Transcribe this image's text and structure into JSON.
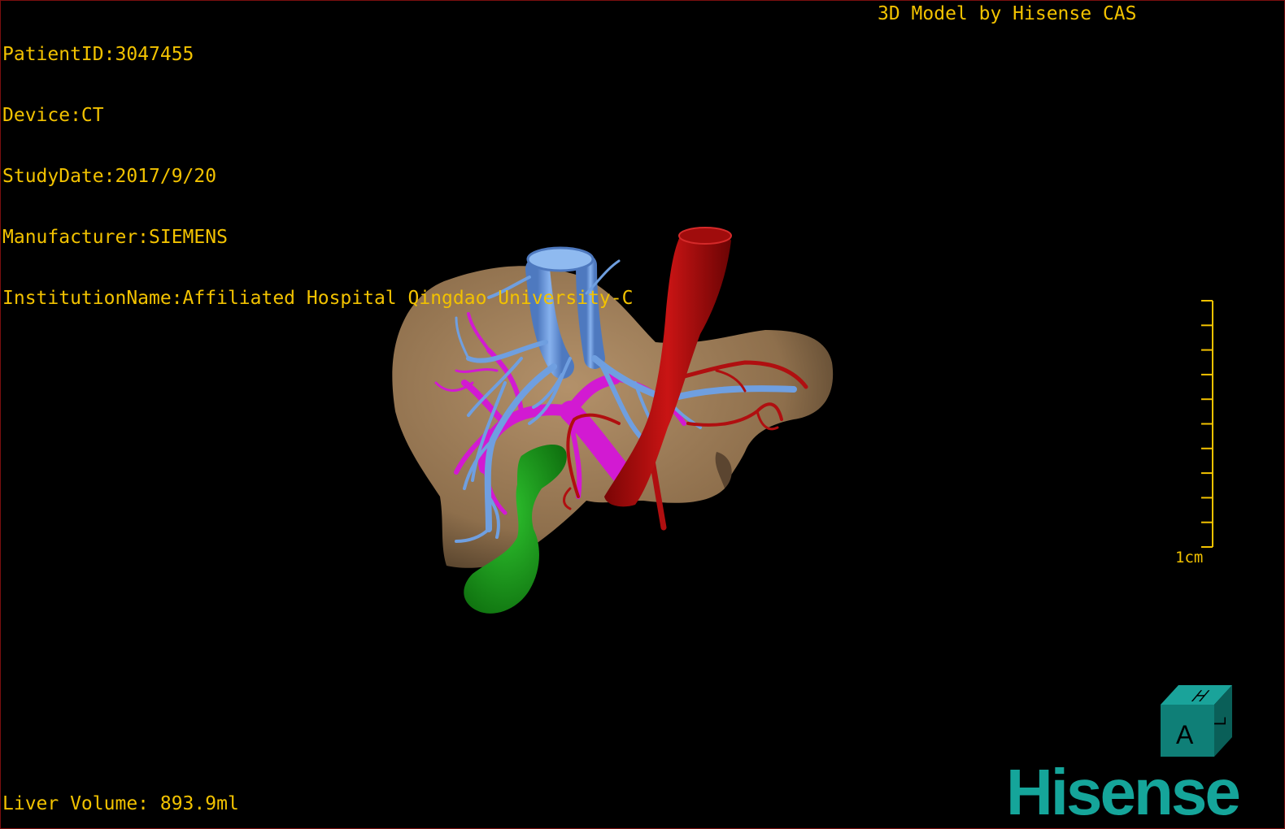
{
  "overlay": {
    "patient_id": "PatientID:3047455",
    "device": "Device:CT",
    "study_date": "StudyDate:2017/9/20",
    "manufacturer": "Manufacturer:SIEMENS",
    "institution": "InstitutionName:Affiliated Hospital Qingdao University-C",
    "model_credit": "3D Model by Hisense CAS",
    "liver_volume": "Liver Volume: 893.9ml"
  },
  "scale_bar": {
    "label": "1cm"
  },
  "orientation_cube": {
    "front": "A",
    "top": "H",
    "side": "L",
    "color": "#0f7f77"
  },
  "logo": {
    "text": "Hisense",
    "color": "#15a59a"
  },
  "colors": {
    "text": "#f2c200",
    "liver": "#9c7c57",
    "hepatic_vein": "#6f9fe0",
    "portal_vein": "#d21ad2",
    "artery": "#b00f10",
    "gallbladder": "#1f9e1f"
  }
}
